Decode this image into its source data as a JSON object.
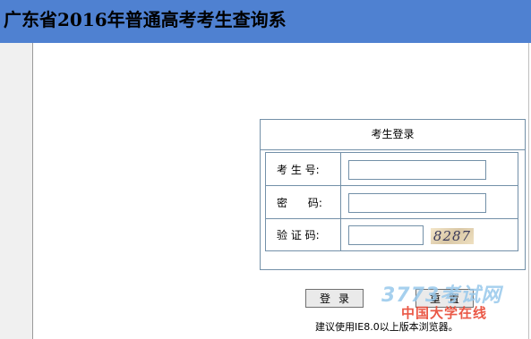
{
  "header": {
    "title": "广东省2016年普通高考考生查询系"
  },
  "login": {
    "title": "考生登录",
    "rows": [
      {
        "label": "考 生 号:",
        "value": ""
      },
      {
        "label": "密      码:",
        "value": ""
      },
      {
        "label": "验 证 码:",
        "value": ""
      }
    ],
    "captcha": "8287"
  },
  "buttons": {
    "login": "登录",
    "reset": "重置"
  },
  "hint": "建议使用IE8.0以上版本浏览器。",
  "watermark": {
    "top": "3773考试网",
    "bottom": "中国大学在线"
  },
  "colors": {
    "header_bg": "#4f81d1",
    "border": "#7390a8",
    "watermark_blue": "#96c8eb",
    "watermark_red": "#e84632"
  }
}
